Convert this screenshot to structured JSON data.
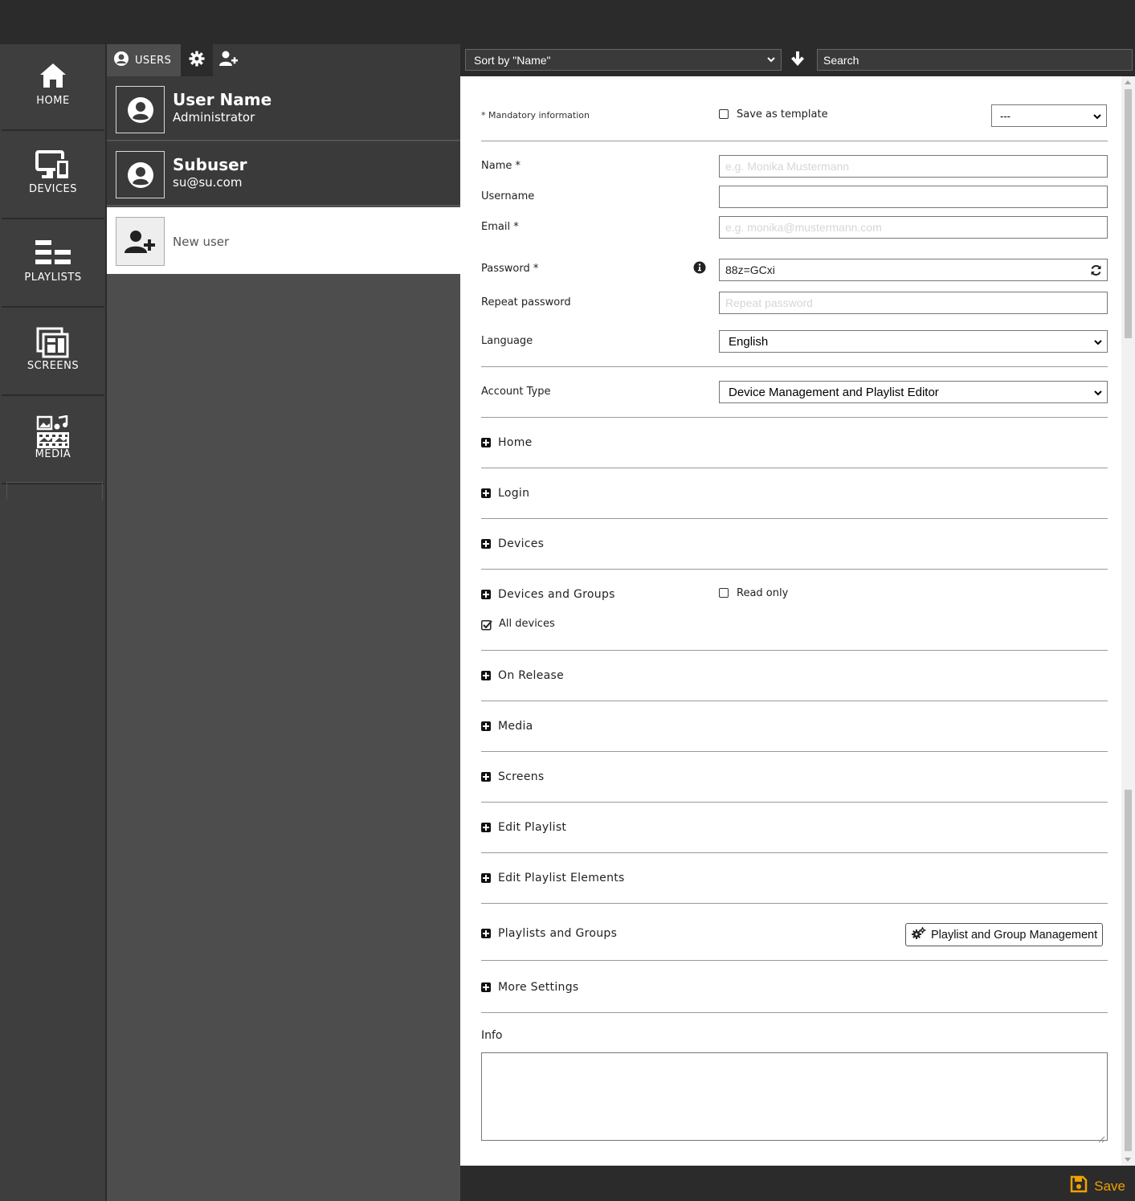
{
  "sidebar": {
    "items": [
      {
        "label": "HOME",
        "icon": "home-icon"
      },
      {
        "label": "DEVICES",
        "icon": "devices-icon"
      },
      {
        "label": "PLAYLISTS",
        "icon": "playlists-icon"
      },
      {
        "label": "SCREENS",
        "icon": "screens-icon"
      },
      {
        "label": "MEDIA",
        "icon": "media-icon"
      }
    ]
  },
  "users_panel": {
    "tab_label": "USERS",
    "users": [
      {
        "name": "User Name",
        "subtitle": "Administrator"
      },
      {
        "name": "Subuser",
        "subtitle": "su@su.com"
      }
    ],
    "new_user_label": "New user"
  },
  "toolbar": {
    "sort_value": "Sort by \"Name\"",
    "search_placeholder": "Search"
  },
  "form": {
    "mandatory_note": "* Mandatory information",
    "save_template_label": "Save as template",
    "template_select_value": "---",
    "name_label": "Name *",
    "name_placeholder": "e.g. Monika Mustermann",
    "username_label": "Username",
    "username_value": "",
    "email_label": "Email *",
    "email_placeholder": "e.g. monika@mustermann.com",
    "password_label": "Password *",
    "password_value": "88z=GCxi",
    "repeat_password_label": "Repeat password",
    "repeat_password_placeholder": "Repeat password",
    "language_label": "Language",
    "language_value": "English",
    "account_type_label": "Account Type",
    "account_type_value": "Device Management and Playlist Editor",
    "sections": {
      "home": "Home",
      "login": "Login",
      "devices": "Devices",
      "devices_groups": "Devices and Groups",
      "on_release": "On Release",
      "media": "Media",
      "screens": "Screens",
      "edit_playlist": "Edit Playlist",
      "edit_playlist_elements": "Edit Playlist Elements",
      "playlists_groups": "Playlists and Groups",
      "more_settings": "More Settings"
    },
    "read_only_label": "Read only",
    "all_devices_label": "All devices",
    "all_devices_checked": true,
    "read_only_checked": false,
    "pgm_button_label": "Playlist and Group Management",
    "info_label": "Info",
    "info_value": ""
  },
  "footer": {
    "save_label": "Save",
    "accent_color": "#f0a000"
  }
}
